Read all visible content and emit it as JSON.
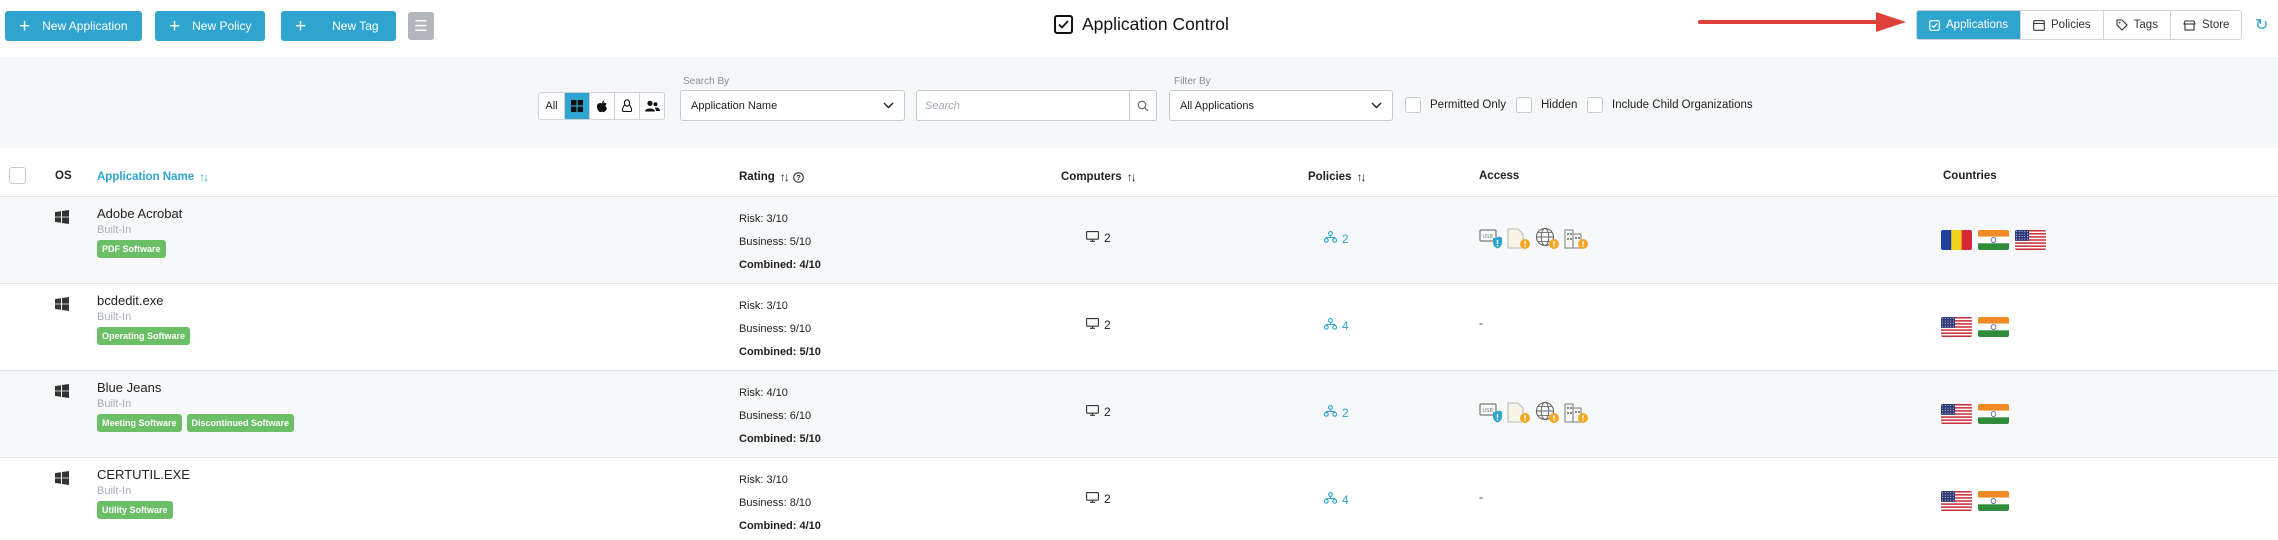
{
  "toolbar": {
    "new_application": "New Application",
    "new_policy": "New Policy",
    "new_tag": "New Tag"
  },
  "page": {
    "title": "Application Control"
  },
  "view_switch": {
    "applications": "Applications",
    "policies": "Policies",
    "tags": "Tags",
    "store": "Store",
    "active": "Applications"
  },
  "filters": {
    "os_all": "All",
    "search_by_label": "Search By",
    "search_by_value": "Application Name",
    "search_placeholder": "Search",
    "filter_by_label": "Filter By",
    "filter_by_value": "All Applications",
    "permitted_only": "Permitted Only",
    "hidden": "Hidden",
    "include_child": "Include Child Organizations"
  },
  "table": {
    "headers": {
      "os": "OS",
      "application_name": "Application Name",
      "rating": "Rating",
      "computers": "Computers",
      "policies": "Policies",
      "access": "Access",
      "countries": "Countries"
    },
    "rows": [
      {
        "name": "Adobe Acrobat",
        "source": "Built-In",
        "tags": [
          "PDF Software"
        ],
        "risk": "Risk: 3/10",
        "business": "Business: 5/10",
        "combined": "Combined: 4/10",
        "computers": "2",
        "policies": "2",
        "access": "icons",
        "countries": [
          "ro",
          "in",
          "us"
        ]
      },
      {
        "name": "bcdedit.exe",
        "source": "Built-In",
        "tags": [
          "Operating Software"
        ],
        "risk": "Risk: 3/10",
        "business": "Business: 9/10",
        "combined": "Combined: 5/10",
        "computers": "2",
        "policies": "4",
        "access": "-",
        "countries": [
          "us",
          "in"
        ]
      },
      {
        "name": "Blue Jeans",
        "source": "Built-In",
        "tags": [
          "Meeting Software",
          "Discontinued Software"
        ],
        "risk": "Risk: 4/10",
        "business": "Business: 6/10",
        "combined": "Combined: 5/10",
        "computers": "2",
        "policies": "2",
        "access": "icons",
        "countries": [
          "us",
          "in"
        ]
      },
      {
        "name": "CERTUTIL.EXE",
        "source": "Built-In",
        "tags": [
          "Utility Software"
        ],
        "risk": "Risk: 3/10",
        "business": "Business: 8/10",
        "combined": "Combined: 4/10",
        "computers": "2",
        "policies": "4",
        "access": "-",
        "countries": [
          "us",
          "in"
        ]
      }
    ]
  },
  "colors": {
    "accent": "#2ea4cf",
    "tag_green": "#6bbf66",
    "warning_orange": "#f5a623",
    "arrow_red": "#e0403a"
  },
  "icons": {
    "access": [
      "usb-shield-icon",
      "file-warning-icon",
      "globe-warning-icon",
      "building-warning-icon"
    ]
  }
}
